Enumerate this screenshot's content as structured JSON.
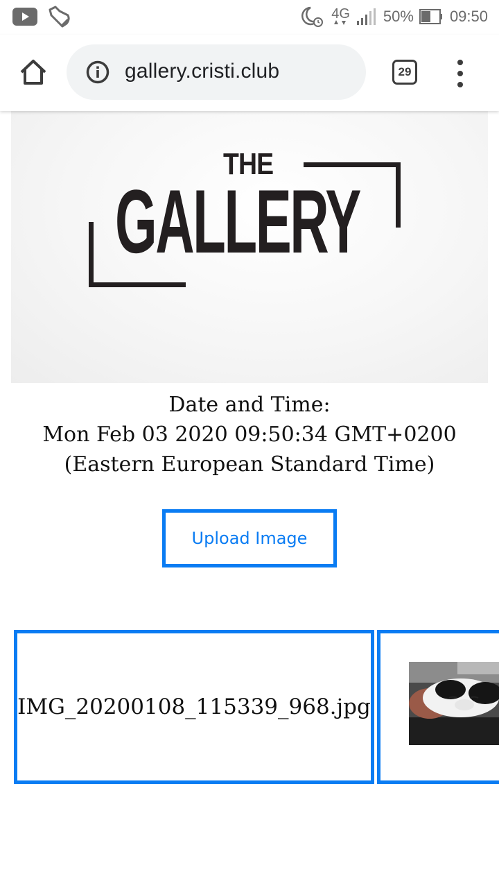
{
  "status_bar": {
    "network": "4G",
    "battery": "50%",
    "time": "09:50",
    "icons": [
      "youtube-icon",
      "notification-icon",
      "night-alarm-icon",
      "network-4g-icon",
      "signal-icon",
      "battery-icon"
    ]
  },
  "browser": {
    "url": "gallery.cristi.club",
    "tab_count": "29",
    "icons": [
      "home-icon",
      "info-icon",
      "tabs-icon",
      "menu-icon"
    ]
  },
  "hero": {
    "logo_small": "THE",
    "logo_main": "GALLERY"
  },
  "datetime": {
    "label": "Date and Time:",
    "value": "Mon Feb 03 2020 09:50:34 GMT+0200",
    "timezone": "(Eastern European Standard Time)"
  },
  "upload": {
    "label": "Upload Image"
  },
  "gallery": {
    "items": [
      {
        "filename": "IMG_20200108_115339_968.jpg"
      }
    ]
  },
  "colors": {
    "accent": "#0a7cf3",
    "logo": "#231f20"
  }
}
